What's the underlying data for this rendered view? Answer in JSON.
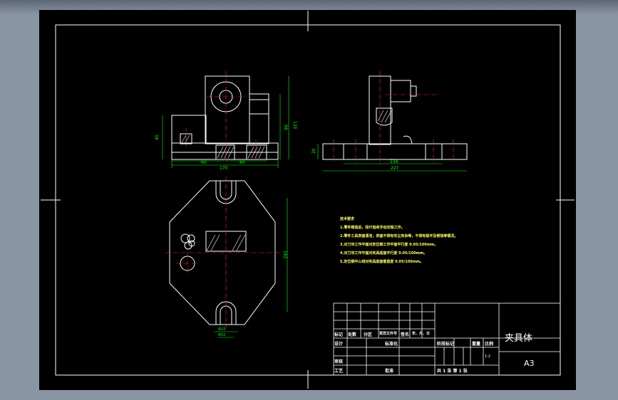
{
  "drawing": {
    "part_name": "夹具体",
    "sheet_size": "A3",
    "scale": "1:2"
  },
  "technical_requirements": {
    "heading": "技术要求",
    "items": [
      "1.零件铸造后，经IT验收手动去除工作。",
      "2.零件工具表面清洁，表面不得有灰尘夹杂等，不得有损坏及锈蚀等情况。",
      "3.对刀块工作平面对定位销工作平面平行度 0.05/100mm。",
      "4.对刀块工作平面对夹具底面平行度 0.05/100mm。",
      "5.定位销中心线对夹具底面垂直度 0.05/100mm。"
    ]
  },
  "title_block": {
    "row_labels": [
      "标记",
      "处数",
      "分区",
      "更改文件号",
      "签名",
      "年、月、日"
    ],
    "design": "设计",
    "standardize": "标准化",
    "stage_mark": "阶段标记",
    "weight": "重量",
    "scale_label": "比例",
    "review": "审核",
    "process": "工艺",
    "approve": "批准",
    "sheets": "共 1 张  第 1 张"
  },
  "dimensions": {
    "front_height": "120",
    "front_left_height": "40",
    "front_right_height": "98",
    "front_dim_a": "60",
    "front_dim_b": "80",
    "front_width": "170",
    "side_height": "20",
    "side_inner": "134",
    "side_width": "227",
    "top_height": "182",
    "top_slot_a": "Φ32",
    "top_slot_b": "Φ22"
  },
  "colors": {
    "background": "#000000",
    "outline": "#ffffff",
    "dimension": "#00ff00",
    "centerline": "#ff3333",
    "notes": "#ffff66",
    "frame_bg": "#8a95a3"
  }
}
